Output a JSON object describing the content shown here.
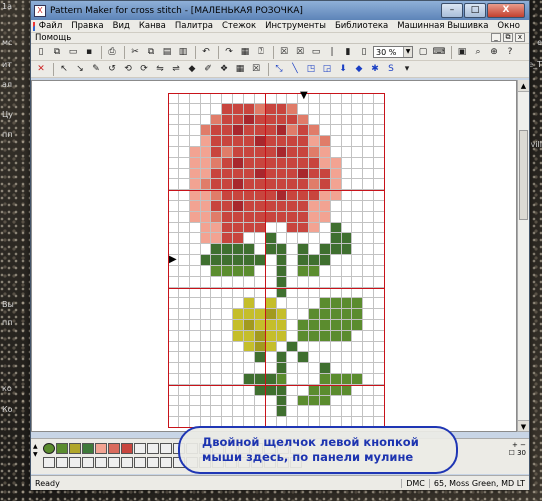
{
  "desktop": {
    "left_text": [
      "1а",
      "мс",
      "ит",
      "ал",
      "Цу",
      "пп",
      "Вы",
      "пп",
      "ко",
      "Ко"
    ],
    "right_text": [
      "e",
      "e_T",
      "vill"
    ]
  },
  "window": {
    "title": "Pattern Maker for cross stitch - [МАЛЕНЬКАЯ РОЗОЧКА]",
    "app_icon": "X",
    "minimize": "–",
    "maximize": "□",
    "close": "X"
  },
  "menu": {
    "items": [
      "Файл",
      "Правка",
      "Вид",
      "Канва",
      "Палитра",
      "Стежок",
      "Инструменты",
      "Библиотека",
      "Машинная Вышивка",
      "Окно"
    ],
    "help": "Помощь",
    "mdi": [
      "_",
      "⧉",
      "x"
    ]
  },
  "toolbar": {
    "zoom": "30 %"
  },
  "palette": {
    "colors": [
      "#5b8c2e",
      "#5b8c2e",
      "#b0a62a",
      "#3f7a3a",
      "#f2a392",
      "#d96a5c",
      "#c8453e",
      "#efefef",
      "#efefef",
      "#efefef",
      "#efefef",
      "#efefef",
      "#efefef",
      "#efefef",
      "#efefef",
      "#efefef",
      "#efefef",
      "#efefef",
      "#efefef",
      "#efefef"
    ],
    "right_symbols": [
      "+",
      "−",
      "☐",
      "30"
    ]
  },
  "status": {
    "left": "Ready",
    "code": "DMC",
    "thread": "65, Moss Green, MD LT"
  },
  "callout": {
    "line1": "Двойной щелчок левой кнопкой",
    "line2": "мыши здесь, по панели мулине"
  }
}
